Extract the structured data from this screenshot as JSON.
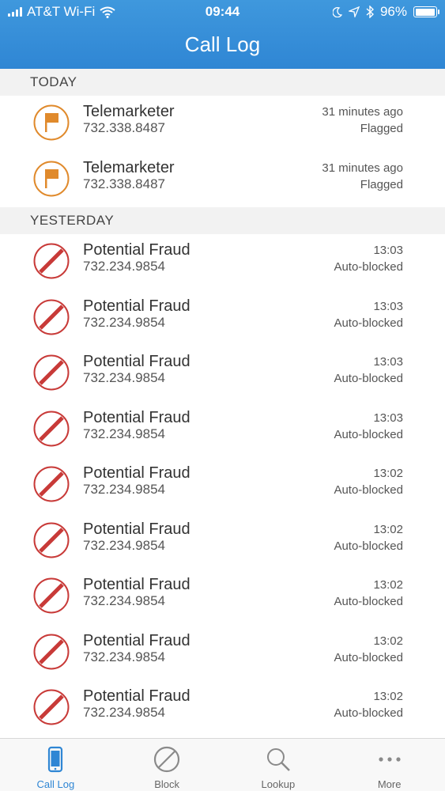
{
  "status_bar": {
    "carrier": "AT&T Wi-Fi",
    "time": "09:44",
    "battery": "96%",
    "battery_level": 0.96,
    "icons": [
      "signal-icon",
      "wifi-icon",
      "moon-icon",
      "location-icon",
      "bluetooth-icon",
      "battery-icon"
    ]
  },
  "header": {
    "title": "Call Log"
  },
  "sections": [
    {
      "label": "TODAY",
      "rows": [
        {
          "name": "Telemarketer",
          "number": "732.338.8487",
          "time": "31 minutes ago",
          "status": "Flagged",
          "icon": "flag-icon"
        },
        {
          "name": "Telemarketer",
          "number": "732.338.8487",
          "time": "31 minutes ago",
          "status": "Flagged",
          "icon": "flag-icon"
        }
      ]
    },
    {
      "label": "YESTERDAY",
      "rows": [
        {
          "name": "Potential Fraud",
          "number": "732.234.9854",
          "time": "13:03",
          "status": "Auto-blocked",
          "icon": "blocked-icon"
        },
        {
          "name": "Potential Fraud",
          "number": "732.234.9854",
          "time": "13:03",
          "status": "Auto-blocked",
          "icon": "blocked-icon"
        },
        {
          "name": "Potential Fraud",
          "number": "732.234.9854",
          "time": "13:03",
          "status": "Auto-blocked",
          "icon": "blocked-icon"
        },
        {
          "name": "Potential Fraud",
          "number": "732.234.9854",
          "time": "13:03",
          "status": "Auto-blocked",
          "icon": "blocked-icon"
        },
        {
          "name": "Potential Fraud",
          "number": "732.234.9854",
          "time": "13:02",
          "status": "Auto-blocked",
          "icon": "blocked-icon"
        },
        {
          "name": "Potential Fraud",
          "number": "732.234.9854",
          "time": "13:02",
          "status": "Auto-blocked",
          "icon": "blocked-icon"
        },
        {
          "name": "Potential Fraud",
          "number": "732.234.9854",
          "time": "13:02",
          "status": "Auto-blocked",
          "icon": "blocked-icon"
        },
        {
          "name": "Potential Fraud",
          "number": "732.234.9854",
          "time": "13:02",
          "status": "Auto-blocked",
          "icon": "blocked-icon"
        },
        {
          "name": "Potential Fraud",
          "number": "732.234.9854",
          "time": "13:02",
          "status": "Auto-blocked",
          "icon": "blocked-icon"
        }
      ]
    }
  ],
  "tabs": [
    {
      "label": "Call Log",
      "icon": "phone-icon",
      "active": true
    },
    {
      "label": "Block",
      "icon": "block-icon",
      "active": false
    },
    {
      "label": "Lookup",
      "icon": "magnifier-icon",
      "active": false
    },
    {
      "label": "More",
      "icon": "more-dots-icon",
      "active": false
    }
  ],
  "colors": {
    "header": "#2f86d4",
    "flag": "#e08a2c",
    "blocked": "#c83a38",
    "tab_active": "#2f86d4",
    "tab_inactive": "#8a8a8a"
  }
}
